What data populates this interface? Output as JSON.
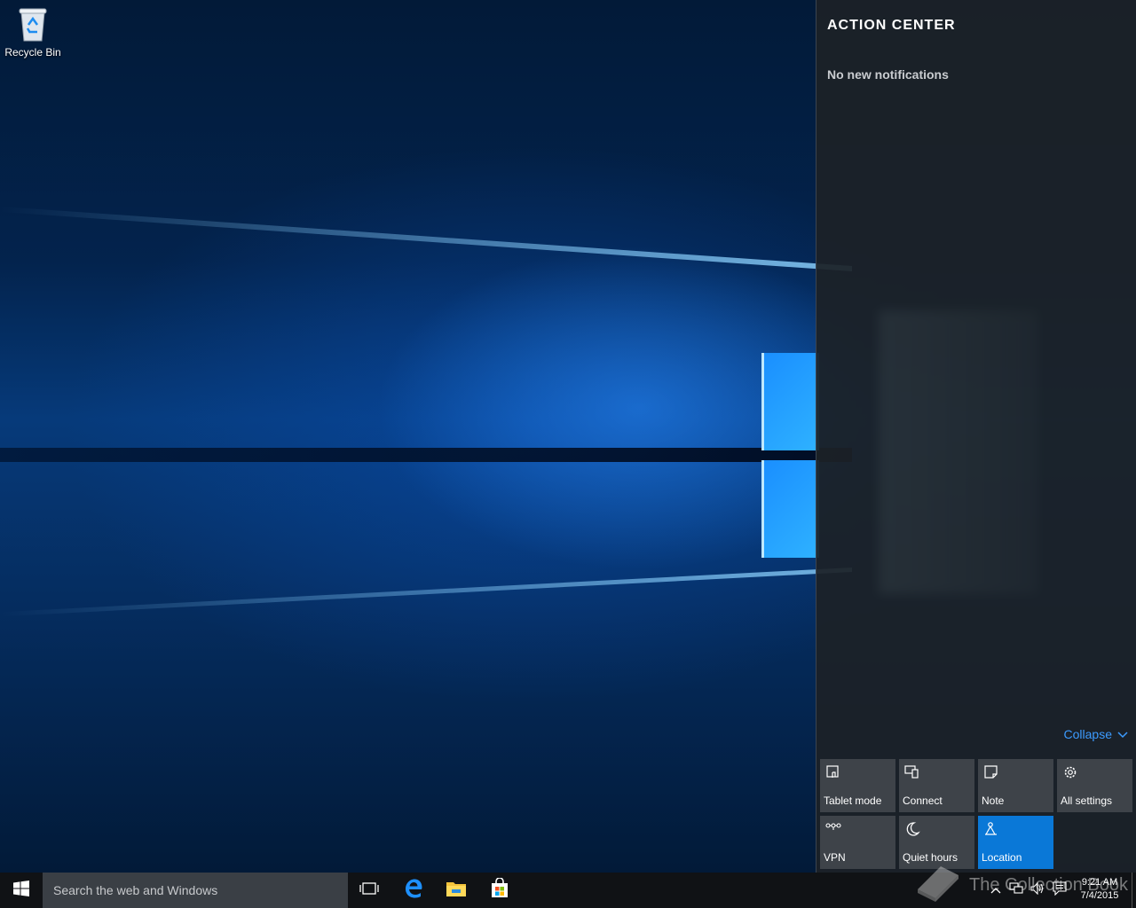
{
  "desktop": {
    "icons": [
      {
        "label": "Recycle Bin"
      }
    ]
  },
  "action_center": {
    "title": "ACTION CENTER",
    "empty_message": "No new notifications",
    "collapse_label": "Collapse",
    "accent_color": "#0a78d7",
    "quick_actions": [
      {
        "label": "Tablet mode",
        "icon": "tablet-mode-icon",
        "active": false
      },
      {
        "label": "Connect",
        "icon": "connect-icon",
        "active": false
      },
      {
        "label": "Note",
        "icon": "note-icon",
        "active": false
      },
      {
        "label": "All settings",
        "icon": "gear-icon",
        "active": false
      },
      {
        "label": "VPN",
        "icon": "vpn-icon",
        "active": false
      },
      {
        "label": "Quiet hours",
        "icon": "moon-icon",
        "active": false
      },
      {
        "label": "Location",
        "icon": "location-icon",
        "active": true
      }
    ]
  },
  "taskbar": {
    "search_placeholder": "Search the web and Windows",
    "pinned": [
      {
        "icon": "task-view-icon"
      },
      {
        "icon": "edge-icon"
      },
      {
        "icon": "file-explorer-icon"
      },
      {
        "icon": "store-icon"
      }
    ],
    "tray": {
      "time": "9:21 AM",
      "date": "7/4/2015"
    }
  },
  "watermark": {
    "text": "The Collection Book"
  }
}
